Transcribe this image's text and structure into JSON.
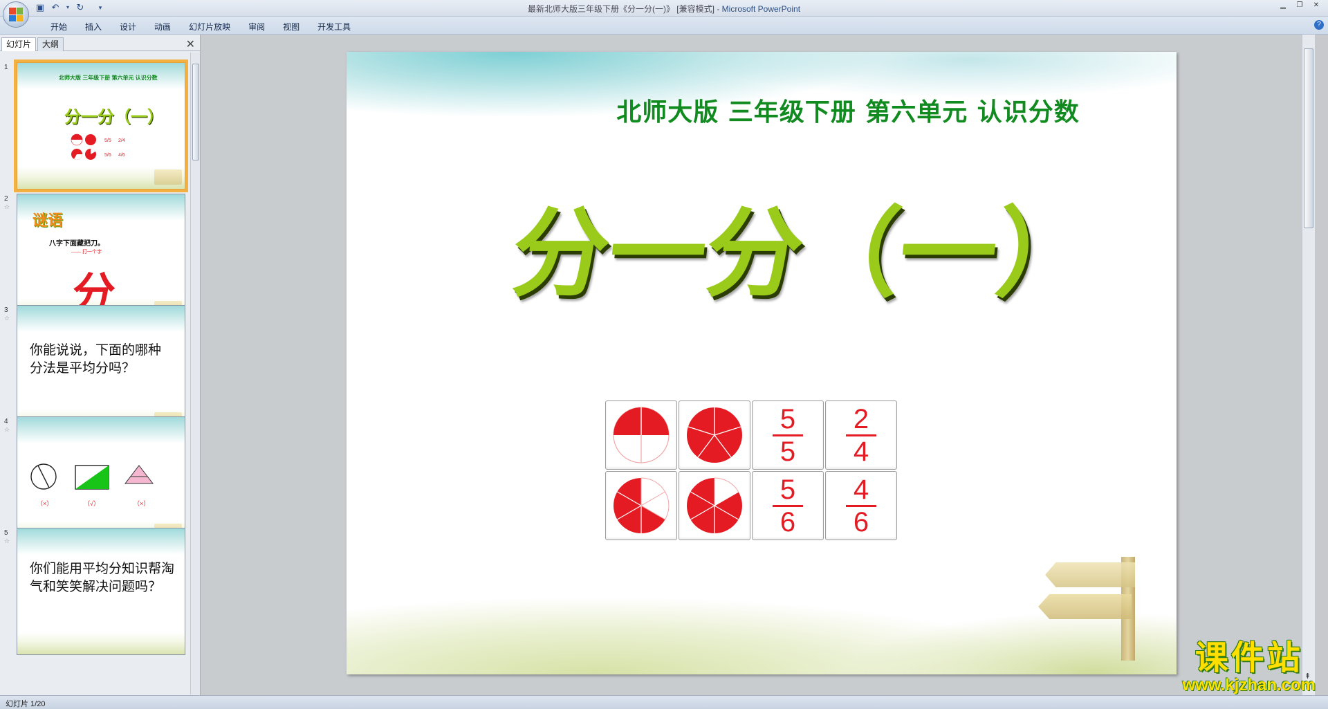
{
  "window": {
    "title": "最新北师大版三年级下册《分一分(一)》 [兼容模式]",
    "app_name": "Microsoft PowerPoint"
  },
  "ribbon": {
    "tabs": [
      "开始",
      "插入",
      "设计",
      "动画",
      "幻灯片放映",
      "审阅",
      "视图",
      "开发工具"
    ]
  },
  "panel": {
    "tabs": [
      "幻灯片",
      "大纲"
    ],
    "thumbnails": [
      {
        "number": "1",
        "header": "北师大版  三年级下册  第六单元  认识分数",
        "title": "分一分（一）",
        "fractions": [
          "5/5",
          "2/4",
          "5/6",
          "4/6"
        ]
      },
      {
        "number": "2",
        "riddle": "谜语",
        "line": "八字下面藏把刀。",
        "hint": "—— 打一个字",
        "answer": "分"
      },
      {
        "number": "3",
        "text": "你能说说，下面的哪种分法是平均分吗？"
      },
      {
        "number": "4",
        "marks": [
          "（×）",
          "（√）",
          "（×）"
        ]
      },
      {
        "number": "5",
        "text": "你们能用平均分知识帮淘气和笑笑解决问题吗？"
      }
    ]
  },
  "slide": {
    "header": "北师大版  三年级下册  第六单元  认识分数",
    "title": "分一分（一）",
    "fractions": [
      {
        "numerator": "5",
        "denominator": "5"
      },
      {
        "numerator": "2",
        "denominator": "4"
      },
      {
        "numerator": "5",
        "denominator": "6"
      },
      {
        "numerator": "4",
        "denominator": "6"
      }
    ]
  },
  "status": {
    "slide_position": "幻灯片 1/20"
  },
  "watermark": {
    "name": "课件站",
    "url": "www.kjzhan.com"
  },
  "colors": {
    "accent_red": "#e51b23",
    "title_green": "#9bcb1a",
    "header_green": "#118a1f",
    "selected_thumb": "#f4b041"
  }
}
